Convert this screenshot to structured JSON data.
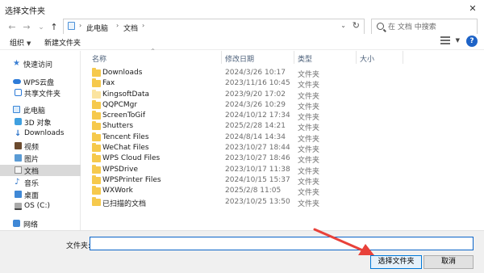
{
  "window": {
    "title": "选择文件夹",
    "close_glyph": "✕"
  },
  "nav": {
    "back": "←",
    "forward": "→",
    "recent": "⌄",
    "up": "↑"
  },
  "address": {
    "icon": "pc-icon",
    "sep1": "›",
    "crumbs": [
      "此电脑",
      "文档"
    ],
    "sep2": "›",
    "sep3": "›",
    "dropdown": "⌄",
    "refresh": "↻"
  },
  "search": {
    "placeholder": "在 文档 中搜索"
  },
  "toolbar": {
    "organize": "组织",
    "organize_caret": "▼",
    "new_folder": "新建文件夹",
    "view_caret": "▼",
    "help": "?"
  },
  "sidebar": {
    "items": [
      {
        "label": "快速访问",
        "icon": "star-icon"
      },
      {
        "label": "WPS云盘",
        "icon": "cloud-icon"
      },
      {
        "label": "共享文件夹",
        "icon": "share-icon"
      },
      {
        "label": "此电脑",
        "icon": "pc-icon"
      },
      {
        "label": "3D 对象",
        "icon": "cube-icon"
      },
      {
        "label": "Downloads",
        "icon": "download-icon"
      },
      {
        "label": "视频",
        "icon": "video-icon"
      },
      {
        "label": "图片",
        "icon": "picture-icon"
      },
      {
        "label": "文档",
        "icon": "document-icon",
        "selected": true
      },
      {
        "label": "音乐",
        "icon": "music-icon"
      },
      {
        "label": "桌面",
        "icon": "desktop-icon"
      },
      {
        "label": "OS (C:)",
        "icon": "drive-icon"
      },
      {
        "label": "网络",
        "icon": "network-icon"
      }
    ],
    "star_glyph": "★",
    "down_glyph": "↓",
    "music_glyph": "♪"
  },
  "columns": {
    "name": "名称",
    "date": "修改日期",
    "type": "类型",
    "size": "大小",
    "sort_glyph": "^"
  },
  "files": [
    {
      "name": "Downloads",
      "date": "2024/3/26 10:17",
      "type": "文件夹"
    },
    {
      "name": "Fax",
      "date": "2023/11/16 10:45",
      "type": "文件夹"
    },
    {
      "name": "KingsoftData",
      "date": "2023/9/20 17:02",
      "type": "文件夹"
    },
    {
      "name": "QQPCMgr",
      "date": "2024/3/26 10:29",
      "type": "文件夹"
    },
    {
      "name": "ScreenToGif",
      "date": "2024/10/12 17:34",
      "type": "文件夹"
    },
    {
      "name": "Shutters",
      "date": "2025/2/28 14:21",
      "type": "文件夹"
    },
    {
      "name": "Tencent Files",
      "date": "2024/8/14 14:34",
      "type": "文件夹"
    },
    {
      "name": "WeChat Files",
      "date": "2023/10/27 18:44",
      "type": "文件夹"
    },
    {
      "name": "WPS Cloud Files",
      "date": "2023/10/27 18:46",
      "type": "文件夹"
    },
    {
      "name": "WPSDrive",
      "date": "2023/10/17 11:38",
      "type": "文件夹"
    },
    {
      "name": "WPSPrinter Files",
      "date": "2024/10/15 15:37",
      "type": "文件夹"
    },
    {
      "name": "WXWork",
      "date": "2025/2/8 11:05",
      "type": "文件夹"
    },
    {
      "name": "已扫描的文档",
      "date": "2023/10/25 13:50",
      "type": "文件夹"
    }
  ],
  "bottom": {
    "folder_label": "文件夹:",
    "folder_value": "",
    "select_button": "选择文件夹",
    "cancel_button": "取消"
  },
  "colors": {
    "accent": "#0078d7",
    "folder": "#f6c94c",
    "arrow": "#e8413a"
  }
}
